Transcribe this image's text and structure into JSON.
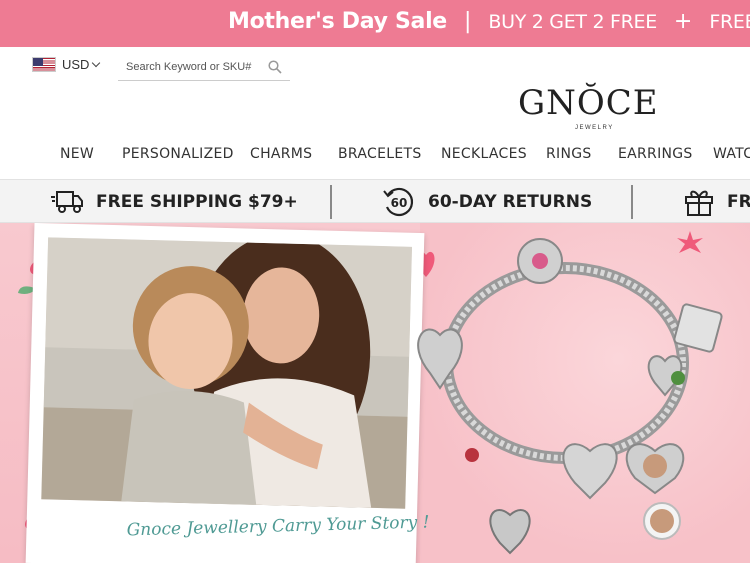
{
  "promo": {
    "title": "Mother's Day Sale",
    "sep1": "|",
    "offer1": "BUY 2 GET 2 FREE",
    "sep2": "+",
    "offer2": "FREE BRACELET WITH"
  },
  "header": {
    "currency": "USD",
    "search_placeholder": "Search Keyword or SKU#",
    "logo": "GNŎCE",
    "logo_sub": "JEWELRY"
  },
  "nav": {
    "items": [
      "NEW",
      "PERSONALIZED",
      "CHARMS",
      "BRACELETS",
      "NECKLACES",
      "RINGS",
      "EARRINGS",
      "WATCHES"
    ]
  },
  "benefits": {
    "items": [
      "FREE SHIPPING $79+",
      "60-DAY RETURNS",
      "FREE GIFT"
    ],
    "returns_badge": "60"
  },
  "hero": {
    "caption": "Gnoce Jewellery Carry Your Story !"
  },
  "colors": {
    "promo_bg": "#ee7b93",
    "hero_bg": "#f8c9cf",
    "caption": "#4f9a94"
  }
}
